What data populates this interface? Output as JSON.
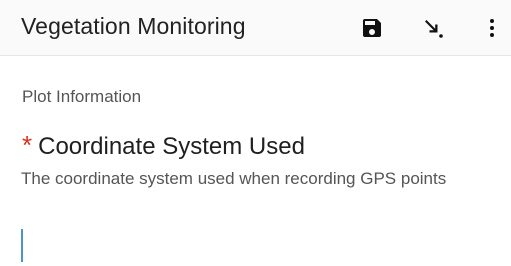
{
  "app_bar": {
    "title": "Vegetation Monitoring",
    "actions": [
      "save-icon",
      "go-to-icon",
      "more-vert-icon"
    ]
  },
  "content": {
    "section_title": "Plot Information",
    "question": {
      "required_marker": "*",
      "label": "Coordinate System Used",
      "hint": "The coordinate system used when recording GPS points",
      "value": ""
    }
  },
  "colors": {
    "app_bar_bg": "#fafafa",
    "required": "#d9321f",
    "caret": "#4d95c7"
  }
}
